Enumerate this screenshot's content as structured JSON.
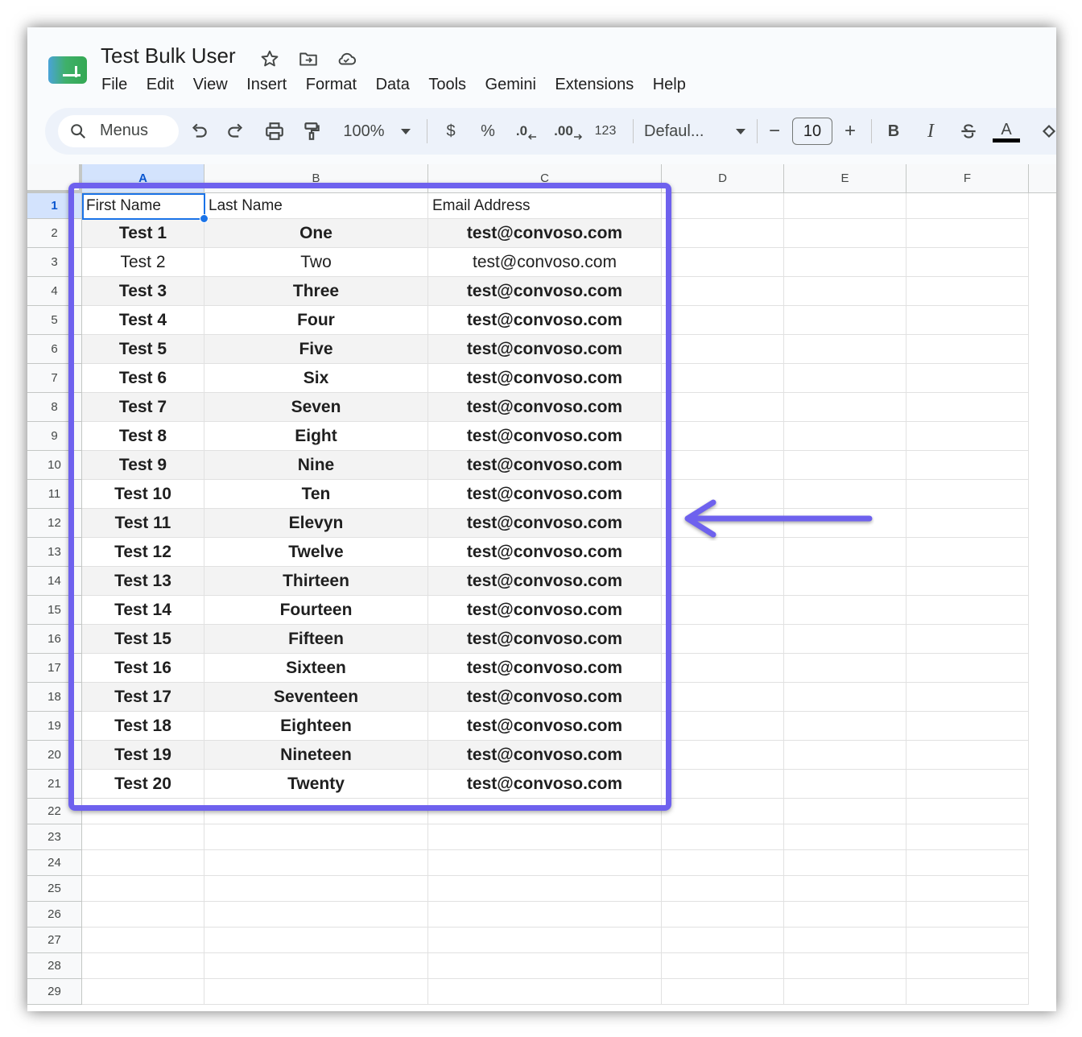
{
  "app": {
    "doc_title": "Test Bulk User",
    "menus": [
      "File",
      "Edit",
      "View",
      "Insert",
      "Format",
      "Data",
      "Tools",
      "Gemini",
      "Extensions",
      "Help"
    ]
  },
  "toolbar": {
    "search_label": "Menus",
    "zoom": "100%",
    "currency": "$",
    "percent": "%",
    "decrease_decimal": ".0",
    "increase_decimal": ".00",
    "number_format": "123",
    "font": "Defaul...",
    "font_size": "10",
    "minus": "−",
    "plus": "+",
    "bold": "B",
    "italic": "I",
    "text_color": "A"
  },
  "sheet": {
    "columns": [
      "A",
      "B",
      "C",
      "D",
      "E",
      "F"
    ],
    "row_numbers": [
      "1",
      "2",
      "3",
      "4",
      "5",
      "6",
      "7",
      "8",
      "9",
      "10",
      "11",
      "12",
      "13",
      "14",
      "15",
      "16",
      "17",
      "18",
      "19",
      "20",
      "21",
      "22",
      "23",
      "24",
      "25",
      "26",
      "27",
      "28",
      "29"
    ],
    "headers": [
      "First Name",
      "Last Name",
      "Email Address"
    ],
    "rows": [
      [
        "Test 1",
        "One",
        "test@convoso.com"
      ],
      [
        "Test 2",
        "Two",
        "test@convoso.com"
      ],
      [
        "Test 3",
        "Three",
        "test@convoso.com"
      ],
      [
        "Test 4",
        "Four",
        "test@convoso.com"
      ],
      [
        "Test 5",
        "Five",
        "test@convoso.com"
      ],
      [
        "Test 6",
        "Six",
        "test@convoso.com"
      ],
      [
        "Test 7",
        "Seven",
        "test@convoso.com"
      ],
      [
        "Test 8",
        "Eight",
        "test@convoso.com"
      ],
      [
        "Test 9",
        "Nine",
        "test@convoso.com"
      ],
      [
        "Test 10",
        "Ten",
        "test@convoso.com"
      ],
      [
        "Test 11",
        "Elevyn",
        "test@convoso.com"
      ],
      [
        "Test 12",
        "Twelve",
        "test@convoso.com"
      ],
      [
        "Test 13",
        "Thirteen",
        "test@convoso.com"
      ],
      [
        "Test 14",
        "Fourteen",
        "test@convoso.com"
      ],
      [
        "Test 15",
        "Fifteen",
        "test@convoso.com"
      ],
      [
        "Test 16",
        "Sixteen",
        "test@convoso.com"
      ],
      [
        "Test 17",
        "Seventeen",
        "test@convoso.com"
      ],
      [
        "Test 18",
        "Eighteen",
        "test@convoso.com"
      ],
      [
        "Test 19",
        "Nineteen",
        "test@convoso.com"
      ],
      [
        "Test 20",
        "Twenty",
        "test@convoso.com"
      ]
    ],
    "row_style": [
      {
        "bold": true,
        "zebra": true
      },
      {
        "bold": false,
        "zebra": false
      },
      {
        "bold": true,
        "zebra": true
      },
      {
        "bold": true,
        "zebra": false
      },
      {
        "bold": true,
        "zebra": true
      },
      {
        "bold": true,
        "zebra": false
      },
      {
        "bold": true,
        "zebra": true
      },
      {
        "bold": true,
        "zebra": false
      },
      {
        "bold": true,
        "zebra": true
      },
      {
        "bold": true,
        "zebra": false
      },
      {
        "bold": true,
        "zebra": true
      },
      {
        "bold": true,
        "zebra": false
      },
      {
        "bold": true,
        "zebra": true
      },
      {
        "bold": true,
        "zebra": false
      },
      {
        "bold": true,
        "zebra": true
      },
      {
        "bold": true,
        "zebra": false
      },
      {
        "bold": true,
        "zebra": true
      },
      {
        "bold": true,
        "zebra": false
      },
      {
        "bold": true,
        "zebra": true
      },
      {
        "bold": true,
        "zebra": false
      }
    ],
    "active_cell": "A1"
  },
  "annotation": {
    "color": "#6e61ee",
    "icons": [
      "highlight-box",
      "arrow-left-icon"
    ]
  },
  "colors": {
    "selection": "#1a73e8",
    "header_bg": "#f8f9fa",
    "toolbar_bg": "#edf2fa"
  }
}
